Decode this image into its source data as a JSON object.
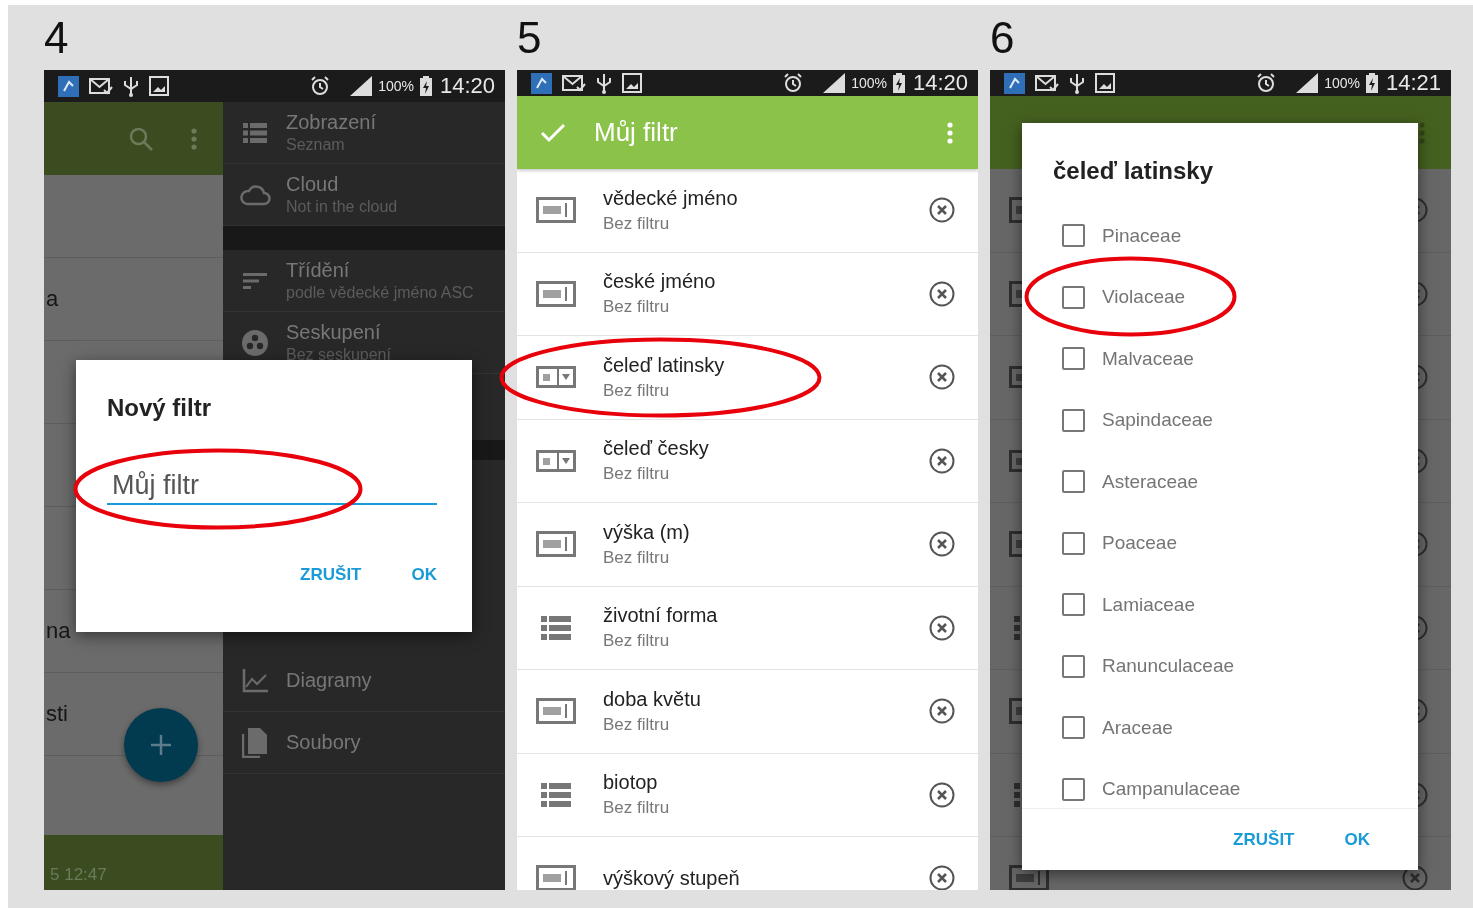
{
  "panels": [
    {
      "kind": "drawer",
      "step": "4",
      "status_bar": {
        "battery": "100%",
        "time": "14:20"
      },
      "list_rows": [
        {},
        {
          "text": "a"
        },
        {},
        {},
        {},
        {
          "text": "na"
        },
        {
          "text": "sti"
        }
      ],
      "footer_text": "5 12:47",
      "drawer_groups": [
        [
          {
            "kind": "list",
            "title": "Zobrazení",
            "subtitle": "Seznam"
          },
          {
            "kind": "cloud",
            "title": "Cloud",
            "subtitle": "Not in the cloud"
          }
        ],
        [
          {
            "kind": "sort",
            "title": "Třídění",
            "subtitle": "podle vědecké jméno ASC"
          },
          {
            "kind": "group",
            "title": "Seskupení",
            "subtitle": "Bez seskupení"
          }
        ],
        [
          {
            "kind": "chart",
            "title": "Diagramy"
          },
          {
            "kind": "file",
            "title": "Soubory"
          }
        ]
      ],
      "dialog": {
        "title": "Nový filtr",
        "field_value": "Můj filtr",
        "field_highlighted": true,
        "buttons": [
          "ZRUŠIT",
          "OK"
        ]
      }
    },
    {
      "kind": "filter",
      "step": "5",
      "status_bar": {
        "battery": "100%",
        "time": "14:20"
      },
      "toolbar_title": "Můj filtr",
      "rows": [
        {
          "kind": "text",
          "title": "vědecké jméno",
          "subtitle": "Bez filtru",
          "highlighted": false
        },
        {
          "kind": "text",
          "title": "české jméno",
          "subtitle": "Bez filtru",
          "highlighted": false
        },
        {
          "kind": "select",
          "title": "čeleď latinsky",
          "subtitle": "Bez filtru",
          "highlighted": true
        },
        {
          "kind": "select",
          "title": "čeleď česky",
          "subtitle": "Bez filtru",
          "highlighted": false
        },
        {
          "kind": "text",
          "title": "výška (m)",
          "subtitle": "Bez filtru",
          "highlighted": false
        },
        {
          "kind": "list",
          "title": "životní forma",
          "subtitle": "Bez filtru",
          "highlighted": false
        },
        {
          "kind": "text",
          "title": "doba květu",
          "subtitle": "Bez filtru",
          "highlighted": false
        },
        {
          "kind": "list",
          "title": "biotop",
          "subtitle": "Bez filtru",
          "highlighted": false
        },
        {
          "kind": "text",
          "title": "výškový stupeň",
          "highlighted": false
        }
      ]
    },
    {
      "kind": "checklist",
      "step": "6",
      "status_bar": {
        "battery": "100%",
        "time": "14:21"
      },
      "background_rows": [
        {
          "kind": "text"
        },
        {
          "kind": "text"
        },
        {
          "kind": "select"
        },
        {
          "kind": "select"
        },
        {
          "kind": "text"
        },
        {
          "kind": "list"
        },
        {
          "kind": "text"
        },
        {
          "kind": "list"
        },
        {
          "kind": "text"
        }
      ],
      "dialog": {
        "title": "čeleď latinsky",
        "buttons": [
          "ZRUŠIT",
          "OK"
        ],
        "options": [
          {
            "label": "Pinaceae",
            "checked": false,
            "highlighted": false
          },
          {
            "label": "Violaceae",
            "checked": false,
            "highlighted": true
          },
          {
            "label": "Malvaceae",
            "checked": false,
            "highlighted": false
          },
          {
            "label": "Sapindaceae",
            "checked": false,
            "highlighted": false
          },
          {
            "label": "Asteraceae",
            "checked": false,
            "highlighted": false
          },
          {
            "label": "Poaceae",
            "checked": false,
            "highlighted": false
          },
          {
            "label": "Lamiaceae",
            "checked": false,
            "highlighted": false
          },
          {
            "label": "Ranunculaceae",
            "checked": false,
            "highlighted": false
          },
          {
            "label": "Araceae",
            "checked": false,
            "highlighted": false
          },
          {
            "label": "Campanulaceae",
            "checked": false,
            "highlighted": false
          }
        ]
      }
    }
  ]
}
